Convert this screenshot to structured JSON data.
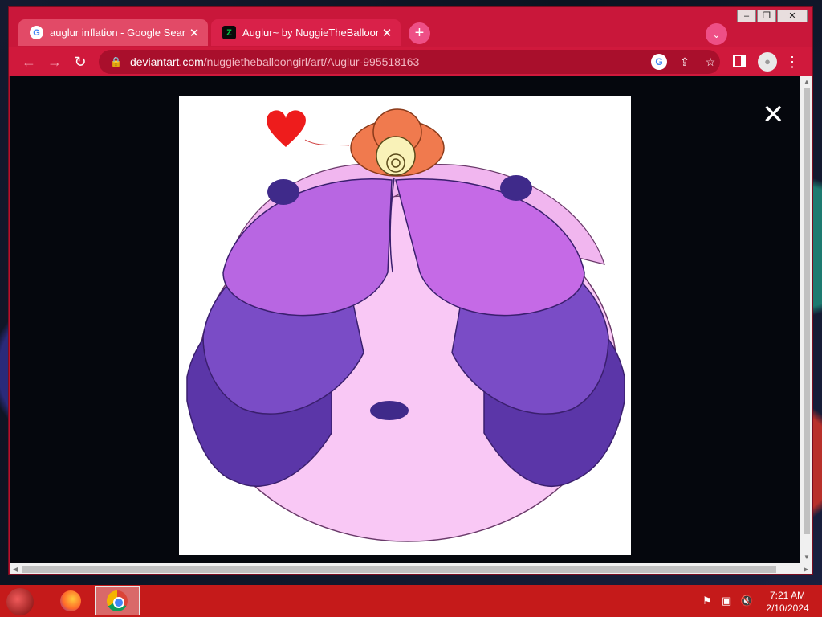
{
  "browser": {
    "tabs": [
      {
        "label": "auglur inflation - Google Search",
        "favicon": "google-icon",
        "active": false
      },
      {
        "label": "Auglur~ by NuggieTheBalloonGi",
        "favicon": "deviantart-icon",
        "active": true
      }
    ],
    "new_tab_symbol": "+",
    "tab_search_symbol": "⌄",
    "window_controls": {
      "minimize": "–",
      "maximize": "❐",
      "close": "✕"
    }
  },
  "toolbar": {
    "back_symbol": "←",
    "forward_symbol": "→",
    "reload_symbol": "↻",
    "url_host": "deviantart.com",
    "url_path": "/nuggietheballoongirl/art/Auglur-995518163",
    "google_lens_symbol": "G",
    "share_symbol": "⇪",
    "bookmark_symbol": "☆",
    "profile_symbol": "●",
    "menu_symbol": "⋮"
  },
  "viewer": {
    "close_symbol": "✕",
    "artwork_subject": "auglur-illustration"
  },
  "taskbar": {
    "apps": [
      "firefox-icon",
      "chrome-icon"
    ],
    "tray": {
      "flag": "⚑",
      "network": "▣",
      "volume": "🔇"
    },
    "clock": {
      "time": "7:21 AM",
      "date": "2/10/2024"
    }
  },
  "colors": {
    "browser_frame": "#c9173a",
    "taskbar": "#c51a1a",
    "viewer_background": "#05070d",
    "deviantart_green": "#05cc47"
  }
}
